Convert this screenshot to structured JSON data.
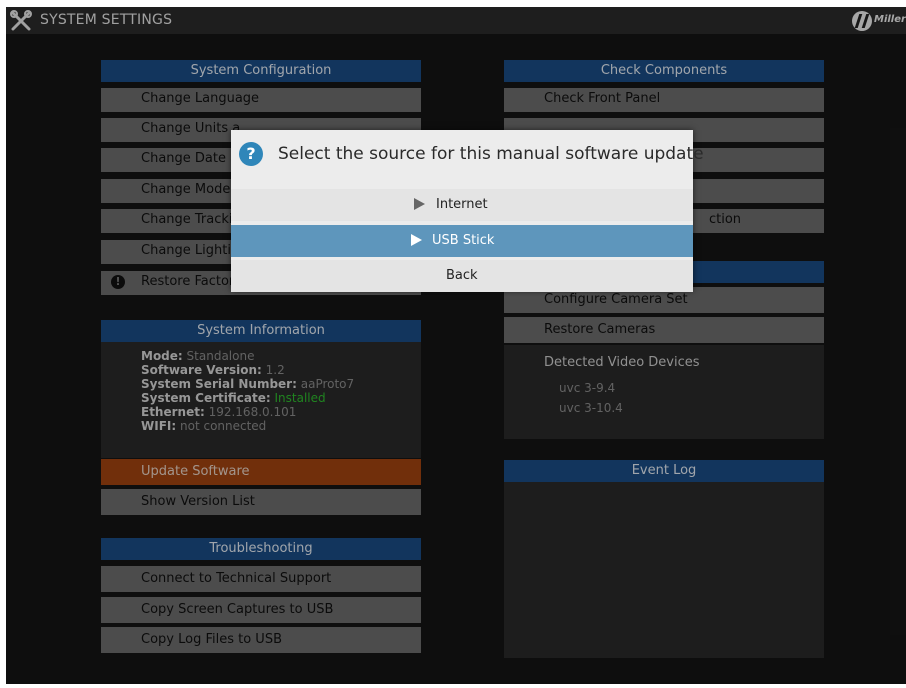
{
  "topbar": {
    "title": "SYSTEM SETTINGS",
    "brand": "Miller"
  },
  "system_configuration": {
    "header": "System Configuration",
    "items": [
      "Change Language",
      "Change Units a",
      "Change Date a",
      "Change Mode",
      "Change Tracki",
      "Change Lightir",
      "Restore Factor"
    ]
  },
  "system_information": {
    "header": "System Information",
    "fields": [
      {
        "label": "Mode:",
        "value": "Standalone"
      },
      {
        "label": "Software Version:",
        "value": "1.2"
      },
      {
        "label": "System Serial Number:",
        "value": "aaProto7"
      },
      {
        "label": "System Certificate:",
        "value": "Installed"
      },
      {
        "label": "Ethernet:",
        "value": "192.168.0.101"
      },
      {
        "label": "WIFI:",
        "value": "not connected"
      }
    ],
    "update_button": "Update Software",
    "version_button": "Show Version List"
  },
  "troubleshooting": {
    "header": "Troubleshooting",
    "items": [
      "Connect to Technical Support",
      "Copy Screen Captures to USB",
      "Copy Log Files to USB"
    ]
  },
  "check_components": {
    "header": "Check Components",
    "items": [
      "Check Front Panel",
      "",
      "",
      "",
      "ction"
    ]
  },
  "cameras": {
    "items": [
      "Configure Camera Set",
      "Restore Cameras"
    ],
    "detected_title": "Detected Video Devices",
    "devices": [
      "uvc 3-9.4",
      "uvc 3-10.4"
    ]
  },
  "event_log": {
    "header": "Event Log"
  },
  "dialog": {
    "question": "Select the source for this manual software update",
    "options": [
      "Internet",
      "USB Stick",
      "Back"
    ],
    "colors": {
      "selected": "#5e96bc",
      "icon": "#2f86b9"
    }
  },
  "colors": {
    "header_blue": "#1b4d86",
    "button_gray": "#6e6e6e",
    "update_orange": "#a24410",
    "installed_green": "#2ebd2e"
  }
}
